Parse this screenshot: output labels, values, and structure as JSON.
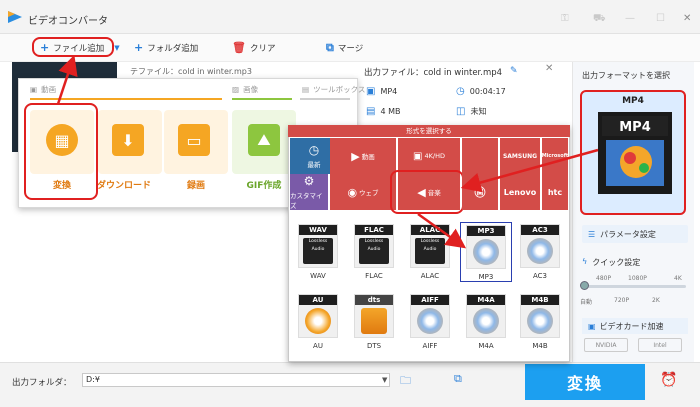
{
  "window": {
    "title": "ビデオコンバータ"
  },
  "toolbar": {
    "add_file": "ファイル追加",
    "add_folder": "フォルダ追加",
    "clear": "クリア",
    "merge": "マージ"
  },
  "file": {
    "source_prefix": "テファイル：cold in winter.mp3",
    "output_label": "出力ファイル：cold in winter.mp4",
    "format": "MP4",
    "duration": "00:04:17",
    "size": "4 MB",
    "unknown": "未知"
  },
  "add_menu": {
    "sections": {
      "video": "動画",
      "image": "画像",
      "toolbox": "ツールボックス"
    },
    "cards": [
      {
        "label": "変換",
        "color": "#f5a623"
      },
      {
        "label": "ダウンロード",
        "color": "#f5a623"
      },
      {
        "label": "録画",
        "color": "#f5a623"
      },
      {
        "label": "GIF作成",
        "color": "#8dc63f"
      }
    ]
  },
  "format_picker": {
    "header": "形式を選択する",
    "categories": [
      {
        "label": "最新",
        "color": "#2f6ea5"
      },
      {
        "label": "動画",
        "color": "#d34c48"
      },
      {
        "label": "4K/HD",
        "color": "#d34c48"
      },
      {
        "label": "カスタマイズ",
        "color": "#7a5aa8"
      },
      {
        "label": "ウェブ",
        "color": "#d34c48"
      },
      {
        "label": "音楽",
        "color": "#d34c48"
      }
    ],
    "brands": [
      "",
      "SAMSUNG",
      "Microsoft",
      "",
      "Lenovo",
      "htc"
    ],
    "formats_row1": [
      {
        "name": "WAV",
        "lossless": true,
        "sub": "Lossless Audio"
      },
      {
        "name": "FLAC",
        "lossless": true,
        "sub": "Lossless Audio"
      },
      {
        "name": "ALAC",
        "lossless": true,
        "sub": "Lossless Audio"
      },
      {
        "name": "MP3",
        "lossless": false
      },
      {
        "name": "AC3",
        "lossless": false
      }
    ],
    "formats_row2": [
      {
        "name": "AU",
        "sub": "Audio Units"
      },
      {
        "name": "DTS"
      },
      {
        "name": "AIFF"
      },
      {
        "name": "M4A"
      },
      {
        "name": "M4B"
      }
    ]
  },
  "right_panel": {
    "format_label": "出力フォーマットを選択",
    "selected_format": "MP4",
    "param_button": "パラメータ設定",
    "quick_setting": "クイック設定",
    "quality_ticks_top": [
      "480P",
      "1080P",
      "4K"
    ],
    "quality_ticks_bottom": [
      "自動",
      "720P",
      "2K"
    ],
    "hw_accel": "ビデオカード加速",
    "chips": [
      "NVIDIA",
      "Intel"
    ]
  },
  "bottom": {
    "output_folder_label": "出力フォルダ：",
    "output_folder_value": "D:¥",
    "convert_button": "変換"
  }
}
